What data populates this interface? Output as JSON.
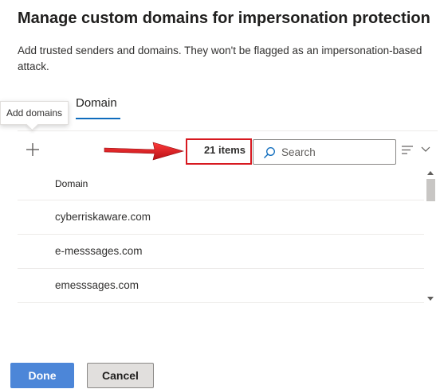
{
  "panel": {
    "title": "Manage custom domains for impersonation protection",
    "description": "Add trusted senders and domains. They won't be flagged as an impersonation-based attack."
  },
  "tooltip": {
    "text": "Add domains"
  },
  "tabs": [
    {
      "label": "Domain",
      "selected": true
    }
  ],
  "toolbar": {
    "add_icon": "plus-icon",
    "items_count": "21 items",
    "search_placeholder": "Search",
    "search_icon": "search-icon",
    "view_icon": "lines-icon",
    "view_chevron": "chevron-down-icon"
  },
  "annotation": {
    "arrow_color": "#d71920",
    "highlight_color": "#d71920"
  },
  "table": {
    "columns": [
      "Domain"
    ],
    "rows": [
      {
        "domain": "cyberriskaware.com"
      },
      {
        "domain": "e-messsages.com"
      },
      {
        "domain": "emesssages.com"
      }
    ]
  },
  "footer": {
    "done_label": "Done",
    "cancel_label": "Cancel"
  },
  "colors": {
    "primary": "#4c86d8",
    "tab_accent": "#0f6cbd"
  }
}
